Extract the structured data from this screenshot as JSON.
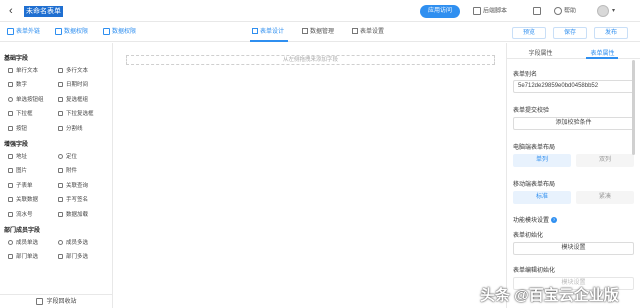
{
  "header": {
    "back_icon": "chevron-left",
    "title": "未命名表单",
    "app_visit": "应用访问",
    "sidebar_script": "后端脚本",
    "help": "帮助",
    "avatar_caret": "▾"
  },
  "toolbar": {
    "links": [
      "表单外链",
      "数据权限",
      "数据权限"
    ],
    "tabs": [
      "表单设计",
      "数据管理",
      "表单设置"
    ],
    "active_tab": "表单设计",
    "buttons": [
      "预览",
      "保存",
      "发布"
    ]
  },
  "left": {
    "sections": [
      {
        "title": "基础字段",
        "fields": [
          "单行文本",
          "多行文本",
          "数字",
          "日期时间",
          "单选按钮组",
          "复选框组",
          "下拉框",
          "下拉复选框",
          "按钮",
          "分割线"
        ]
      },
      {
        "title": "增强字段",
        "fields": [
          "地址",
          "定位",
          "图片",
          "附件",
          "子表单",
          "关联查询",
          "关联数据",
          "手写签名",
          "流水号",
          "数据加载"
        ]
      },
      {
        "title": "部门成员字段",
        "fields": [
          "成员单选",
          "成员多选",
          "部门单选",
          "部门多选"
        ]
      }
    ],
    "recycle_bin": "字段回收站"
  },
  "canvas": {
    "dropzone_text": "从左侧拖拽来添加字段"
  },
  "right": {
    "tabs": [
      "字段属性",
      "表单属性"
    ],
    "active_tab": "表单属性",
    "alias_label": "表单别名",
    "alias_value": "5e712de29859e0bd0458bb52",
    "submit_check_label": "表单提交校验",
    "add_check_button": "添加校验条件",
    "pc_layout_label": "电脑端表单布局",
    "pc_layout_options": [
      "单列",
      "双列"
    ],
    "mobile_layout_label": "移动端表单布局",
    "mobile_layout_options": [
      "标准",
      "紧凑"
    ],
    "module_settings_label": "功能模块设置",
    "init_label": "表单初始化",
    "module_settings_button": "模块设置",
    "edit_init_label": "表单编辑初始化"
  },
  "watermark": "头条 @百宝云企业版"
}
